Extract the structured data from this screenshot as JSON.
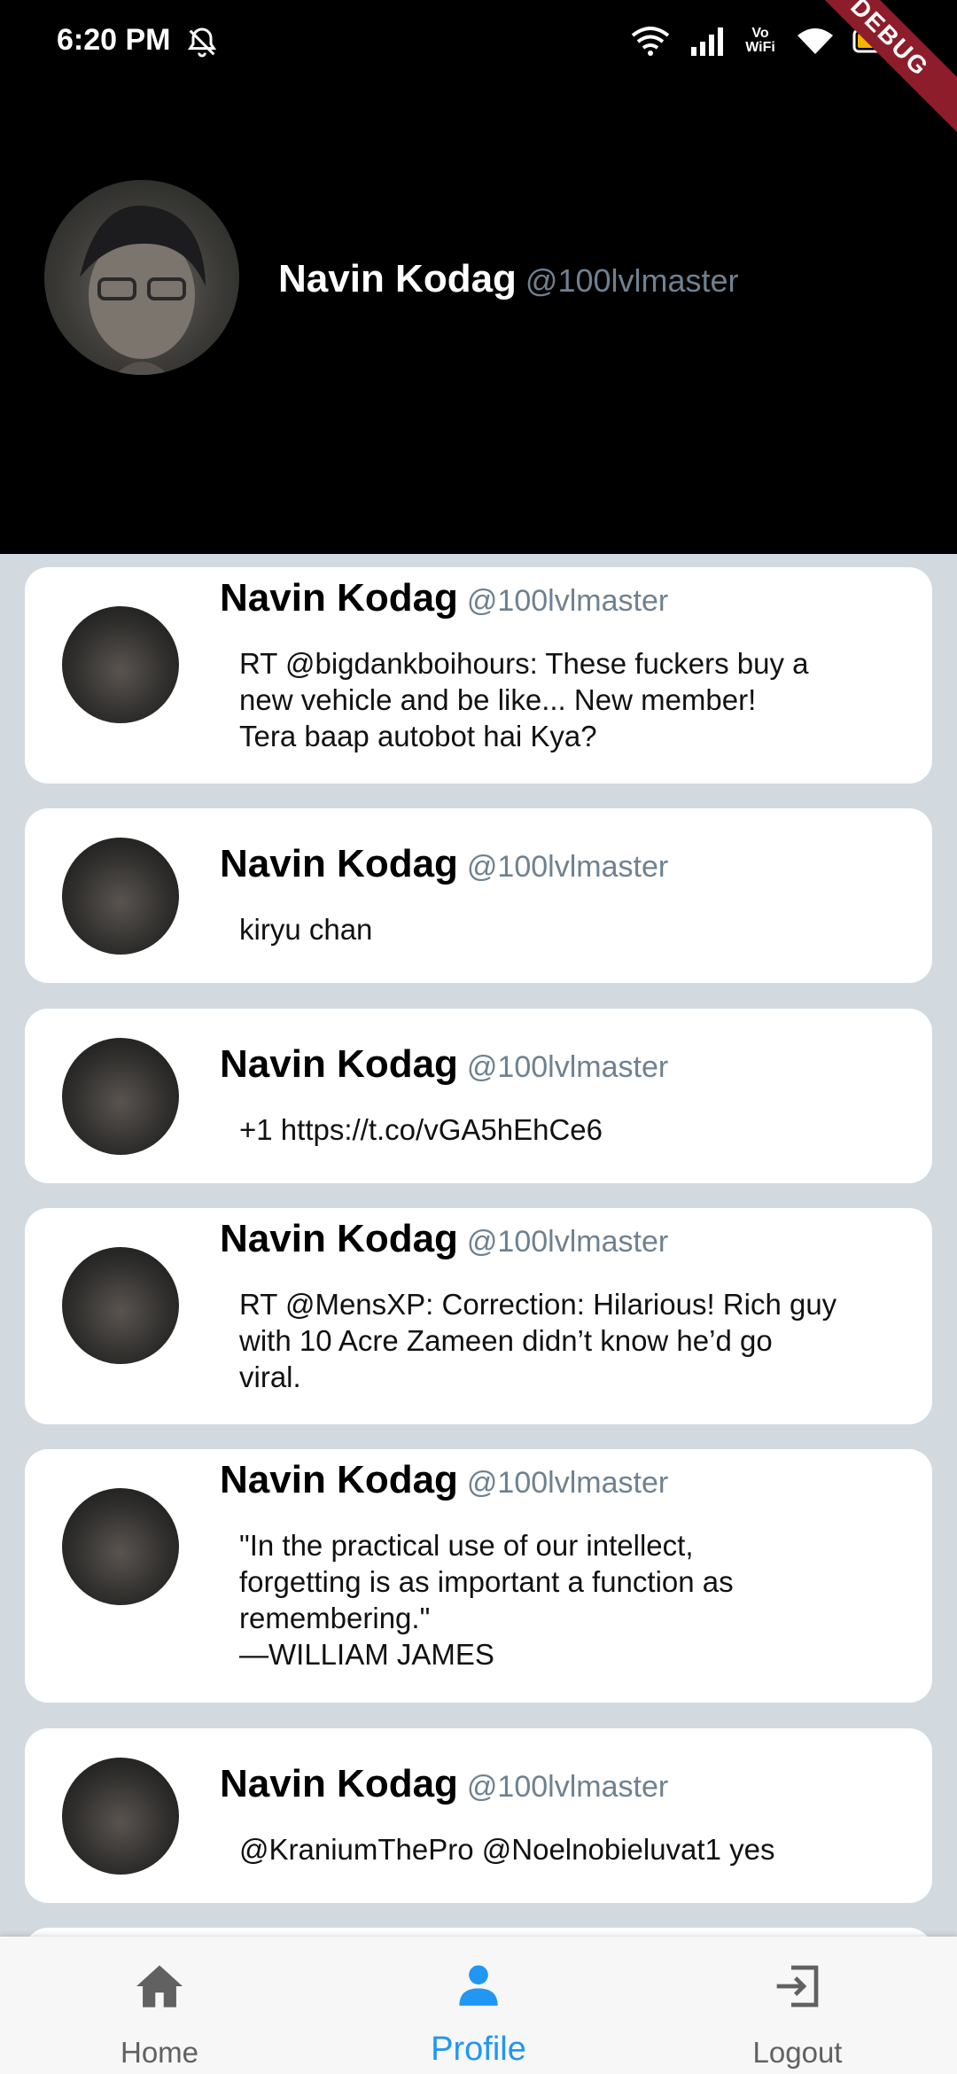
{
  "status_bar": {
    "time": "6:20 PM",
    "icons": [
      "bell-off-icon",
      "wifi-link-icon",
      "signal-icon",
      "vowifi-icon",
      "wifi-icon",
      "battery-icon"
    ],
    "vowifi_label": "Vo\nWiFi"
  },
  "debug_banner": "DEBUG",
  "profile": {
    "name": "Navin Kodag",
    "handle": "@100lvlmaster"
  },
  "tweets": [
    {
      "name": "Navin Kodag",
      "handle": "@100lvlmaster",
      "text": "RT @bigdankboihours: These fuckers buy a\nnew vehicle and be like... New member!\nTera baap autobot hai Kya?"
    },
    {
      "name": "Navin Kodag",
      "handle": "@100lvlmaster",
      "text": "kiryu chan"
    },
    {
      "name": "Navin Kodag",
      "handle": "@100lvlmaster",
      "text": "+1 https://t.co/vGA5hEhCe6"
    },
    {
      "name": "Navin Kodag",
      "handle": "@100lvlmaster",
      "text": "RT @MensXP: Correction: Hilarious! Rich guy\nwith 10 Acre Zameen didn’t know he’d go\nviral."
    },
    {
      "name": "Navin Kodag",
      "handle": "@100lvlmaster",
      "text": "\"In the practical use of our intellect,\nforgetting is as important a function as\nremembering.\"\n        —WILLIAM JAMES"
    },
    {
      "name": "Navin Kodag",
      "handle": "@100lvlmaster",
      "text": "@KraniumThePro @Noelnobieluvat1 yes"
    }
  ],
  "nav": {
    "items": [
      {
        "label": "Home",
        "icon": "home-icon",
        "active": false
      },
      {
        "label": "Profile",
        "icon": "person-icon",
        "active": true
      },
      {
        "label": "Logout",
        "icon": "logout-icon",
        "active": false
      }
    ],
    "active_color": "#2196f3",
    "inactive_color": "#616161"
  }
}
